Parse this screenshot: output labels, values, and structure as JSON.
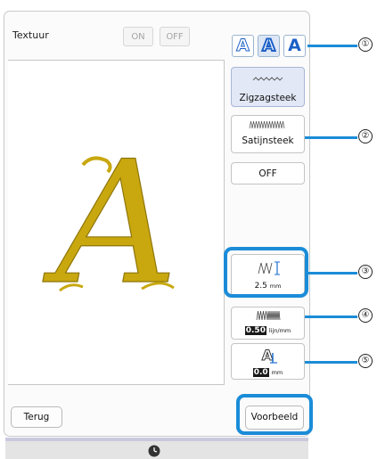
{
  "texture": {
    "label": "Textuur",
    "on_label": "ON",
    "off_label": "OFF"
  },
  "font_buttons": [
    "A",
    "A",
    "A"
  ],
  "stitch_types": {
    "zigzag_label": "Zigzagsteek",
    "satin_label": "Satijnsteek",
    "off_label": "OFF"
  },
  "settings": {
    "width_value": "2.5",
    "width_unit": "mm",
    "density_value": "0.50",
    "density_unit": "lijn/mm",
    "offset_value": "0.0",
    "offset_unit": "mm"
  },
  "footer": {
    "back_label": "Terug",
    "preview_label": "Voorbeeld"
  },
  "preview_letter": "A",
  "callouts": [
    "①",
    "②",
    "③",
    "④",
    "⑤"
  ],
  "colors": {
    "accent": "#1b8cd8",
    "letter_gold": "#c9a80f",
    "font_blue": "#1b5fc7"
  }
}
